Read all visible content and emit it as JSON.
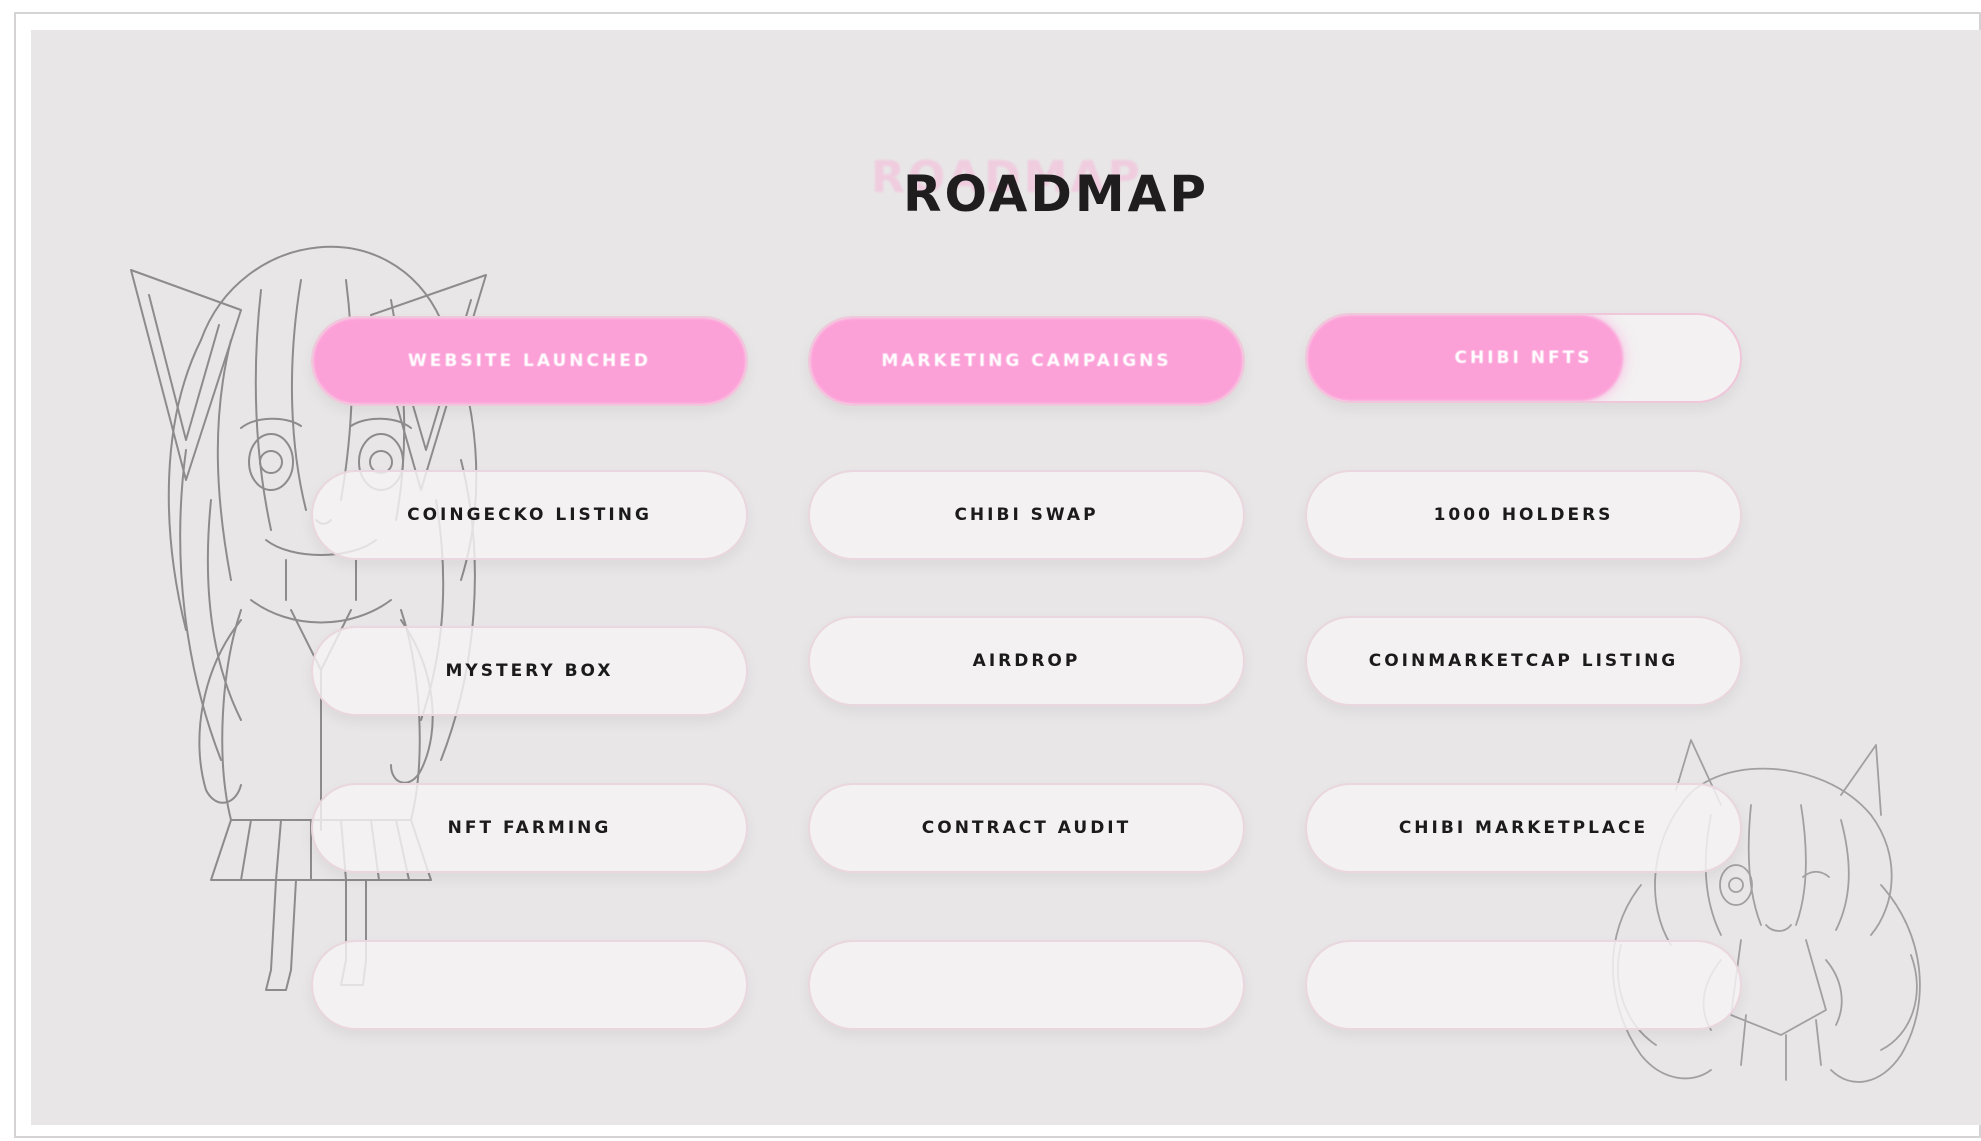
{
  "section": {
    "title": "ROADMAP",
    "accent_color": "#fca1d8",
    "background_color": "#e8e6e7"
  },
  "roadmap": {
    "columns": [
      [
        {
          "label": "WEBSITE LAUNCHED",
          "progress": 1.0
        },
        {
          "label": "COINGECKO LISTING",
          "progress": 0
        },
        {
          "label": "MYSTERY BOX",
          "progress": 0
        },
        {
          "label": "NFT FARMING",
          "progress": 0
        },
        {
          "label": "",
          "progress": 0
        }
      ],
      [
        {
          "label": "MARKETING CAMPAIGNS",
          "progress": 1.0
        },
        {
          "label": "CHIBI SWAP",
          "progress": 0
        },
        {
          "label": "AIRDROP",
          "progress": 0
        },
        {
          "label": "CONTRACT AUDIT",
          "progress": 0
        },
        {
          "label": "",
          "progress": 0
        }
      ],
      [
        {
          "label": "CHIBI NFTS",
          "progress": 0.73
        },
        {
          "label": "1000 HOLDERS",
          "progress": 0
        },
        {
          "label": "COINMARKETCAP LISTING",
          "progress": 0
        },
        {
          "label": "CHIBI MARKETPLACE",
          "progress": 0
        },
        {
          "label": "",
          "progress": 0
        }
      ]
    ]
  },
  "illustrations": [
    {
      "name": "chibi-catgirl-line-art"
    },
    {
      "name": "chibi-foxgirl-line-art"
    }
  ]
}
